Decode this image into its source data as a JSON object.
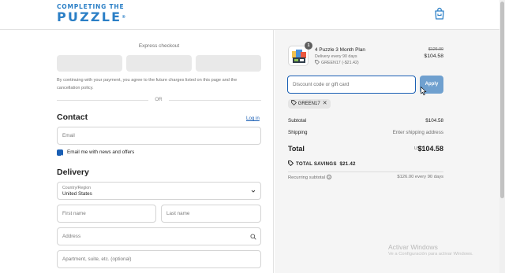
{
  "header": {
    "logo_top": "COMPLETING THE",
    "logo_bottom": "PUZZLE",
    "logo_mark": "®",
    "cart_icon": "shopping-bag-icon"
  },
  "express": {
    "title": "Express checkout",
    "legal": "By continuing with your payment, you agree to the future charges listed on this page and the cancellation policy.",
    "or": "OR"
  },
  "contact": {
    "title": "Contact",
    "login": "Log in",
    "email_placeholder": "Email",
    "news_label": "Email me with news and offers",
    "news_checked": true
  },
  "delivery": {
    "title": "Delivery",
    "country_label": "Country/Region",
    "country_value": "United States",
    "first_name_placeholder": "First name",
    "last_name_placeholder": "Last name",
    "address_placeholder": "Address",
    "apartment_placeholder": "Apartment, suite, etc. (optional)"
  },
  "order": {
    "quantity": "1",
    "product_name": "4 Puzzle 3 Month Plan",
    "frequency": "Delivery every 90 days",
    "discount_line": "GREEN17 (-$21.42)",
    "price_original": "$126.00",
    "price_current": "$104.58"
  },
  "discount": {
    "placeholder": "Discount code or gift card",
    "apply_label": "Apply",
    "applied_code": "GREEN17"
  },
  "summary": {
    "subtotal_label": "Subtotal",
    "subtotal_value": "$104.58",
    "shipping_label": "Shipping",
    "shipping_value": "Enter shipping address",
    "total_label": "Total",
    "currency": "USD",
    "total_value": "$104.58",
    "savings_label": "TOTAL SAVINGS",
    "savings_value": "$21.42",
    "recurring_label": "Recurring subtotal",
    "recurring_value": "$126.00 every 90 days"
  },
  "watermark": {
    "title": "Activar Windows",
    "subtitle": "Ve a Configuración para activar Windows."
  },
  "colors": {
    "brand": "#2b7fc6",
    "link": "#1a5fb4",
    "apply_button": "#6fa0cf",
    "summary_bg": "#f5f5f5"
  }
}
